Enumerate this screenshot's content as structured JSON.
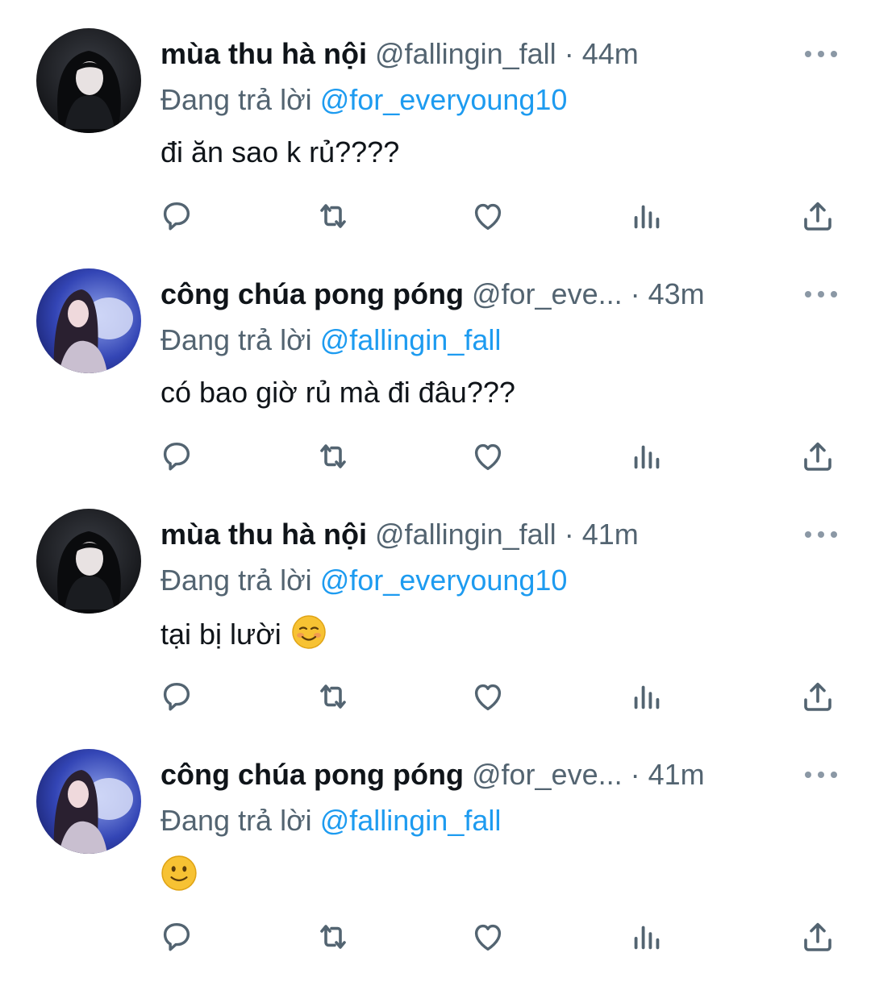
{
  "tweets": [
    {
      "author_name": "mùa thu hà nội",
      "handle": "@fallingin_fall",
      "separator": "·",
      "time": "44m",
      "reply_prefix": "Đang trả lời",
      "reply_to": "@for_everyoung10",
      "text": "đi ăn sao k rủ????",
      "emoji": ""
    },
    {
      "author_name": "công chúa pong póng",
      "handle": "@for_eve...",
      "separator": "·",
      "time": "43m",
      "reply_prefix": "Đang trả lời",
      "reply_to": "@fallingin_fall",
      "text": "có bao giờ rủ mà đi đâu???",
      "emoji": ""
    },
    {
      "author_name": "mùa thu hà nội",
      "handle": "@fallingin_fall",
      "separator": "·",
      "time": "41m",
      "reply_prefix": "Đang trả lời",
      "reply_to": "@for_everyoung10",
      "text": "tại bị lười ",
      "emoji": "smiling-face-emoji"
    },
    {
      "author_name": "công chúa pong póng",
      "handle": "@for_eve...",
      "separator": "·",
      "time": "41m",
      "reply_prefix": "Đang trả lời",
      "reply_to": "@fallingin_fall",
      "text": "",
      "emoji": "slightly-smiling-face-emoji"
    }
  ],
  "icons": {
    "more": "more-horizontal-icon",
    "reply": "reply-icon",
    "retweet": "retweet-icon",
    "like": "heart-icon",
    "views": "views-icon",
    "share": "share-icon"
  },
  "colors": {
    "text": "#0f1419",
    "secondary": "#536471",
    "mention": "#1d9bf0",
    "action_icon": "#536471",
    "more_icon": "#8b98a5",
    "avatar_dark": "#1b1d21",
    "avatar_blue": "#2c3ea8"
  }
}
